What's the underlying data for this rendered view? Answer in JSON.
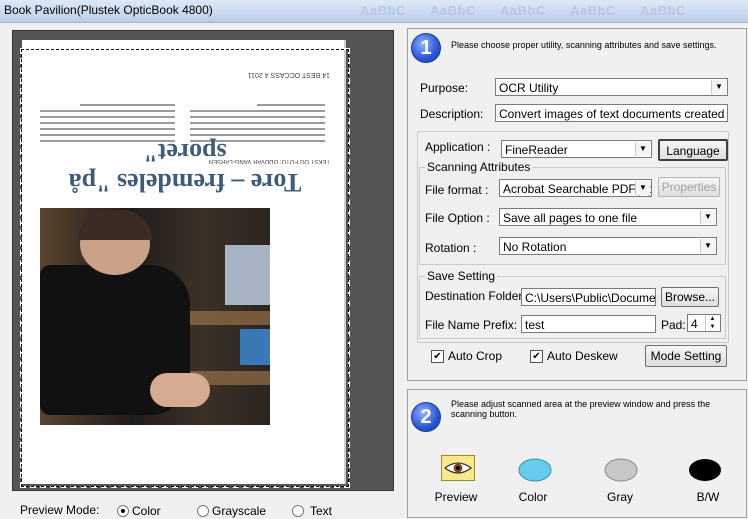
{
  "window": {
    "title": "Book Pavilion(Plustek OpticBook 4800)"
  },
  "preview": {
    "heading": "Tore – fremdeles \"på sporet\"",
    "header_line": "14   BEST OCCASS 4 2011",
    "byline": "TEKST OG FOTO: ODDVAR VANG-LARSEN",
    "mode_label": "Preview Mode:",
    "modes": [
      "Color",
      "Grayscale",
      "Text"
    ],
    "selected_mode": "Color"
  },
  "step1": {
    "number": "1",
    "instruction": "Please choose proper utility, scanning attributes and save settings.",
    "purpose_label": "Purpose:",
    "purpose_value": "OCR Utility",
    "description_label": "Description:",
    "description_value": "Convert images of text documents created by the",
    "application_label": "Application :",
    "application_value": "FineReader",
    "language_button": "Language",
    "scanning_attributes_legend": "Scanning Attributes",
    "file_format_label": "File format :",
    "file_format_value": "Acrobat Searchable PDF(*.p",
    "properties_button": "Properties",
    "file_option_label": "File Option :",
    "file_option_value": "Save all pages to one file",
    "rotation_label": "Rotation :",
    "rotation_value": "No Rotation",
    "save_setting_legend": "Save Setting",
    "destination_label": "Destination Folder:",
    "destination_value": "C:\\Users\\Public\\Document",
    "browse_button": "Browse...",
    "prefix_label": "File Name Prefix:",
    "prefix_value": "test",
    "pad_label": "Pad:",
    "pad_value": "4",
    "auto_crop_label": "Auto Crop",
    "auto_deskew_label": "Auto Deskew",
    "auto_crop_checked": true,
    "auto_deskew_checked": true,
    "mode_setting_button": "Mode Setting"
  },
  "step2": {
    "number": "2",
    "instruction": "Please adjust scanned area at the preview window and press the scanning button.",
    "tools": [
      {
        "label": "Preview",
        "icon": "eye-preview-icon"
      },
      {
        "label": "Color",
        "icon": "color-scan-icon"
      },
      {
        "label": "Gray",
        "icon": "gray-scan-icon"
      },
      {
        "label": "B/W",
        "icon": "bw-scan-icon"
      }
    ]
  },
  "colors": {
    "step_blue": "#2a55d4",
    "heading_blue": "#3e5b7c",
    "color_scan": "#66ccee",
    "gray_scan": "#c8c8c8",
    "bw_scan": "#000000"
  }
}
